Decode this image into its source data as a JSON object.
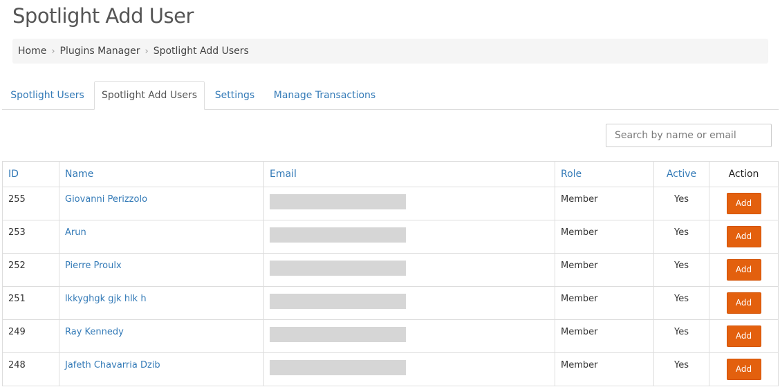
{
  "page": {
    "title": "Spotlight Add User"
  },
  "breadcrumb": {
    "items": [
      "Home",
      "Plugins Manager",
      "Spotlight Add Users"
    ]
  },
  "tabs": [
    {
      "label": "Spotlight Users"
    },
    {
      "label": "Spotlight Add Users"
    },
    {
      "label": "Settings"
    },
    {
      "label": "Manage Transactions"
    }
  ],
  "active_tab": "Spotlight Add Users",
  "search": {
    "placeholder": "Search by name or email",
    "value": ""
  },
  "table": {
    "columns": {
      "id": "ID",
      "name": "Name",
      "email": "Email",
      "role": "Role",
      "active": "Active",
      "action": "Action"
    },
    "rows": [
      {
        "id": "255",
        "name": "Giovanni Perizzolo",
        "role": "Member",
        "active": "Yes",
        "action": "Add"
      },
      {
        "id": "253",
        "name": "Arun",
        "role": "Member",
        "active": "Yes",
        "action": "Add"
      },
      {
        "id": "252",
        "name": "Pierre Proulx",
        "role": "Member",
        "active": "Yes",
        "action": "Add"
      },
      {
        "id": "251",
        "name": "lkkyghgk gjk hlk h",
        "role": "Member",
        "active": "Yes",
        "action": "Add"
      },
      {
        "id": "249",
        "name": "Ray Kennedy",
        "role": "Member",
        "active": "Yes",
        "action": "Add"
      },
      {
        "id": "248",
        "name": "Jafeth Chavarria Dzib",
        "role": "Member",
        "active": "Yes",
        "action": "Add"
      }
    ]
  },
  "colors": {
    "link": "#337ab7",
    "add_button": "#e3600e",
    "email_redaction": "#d6d6d6"
  }
}
